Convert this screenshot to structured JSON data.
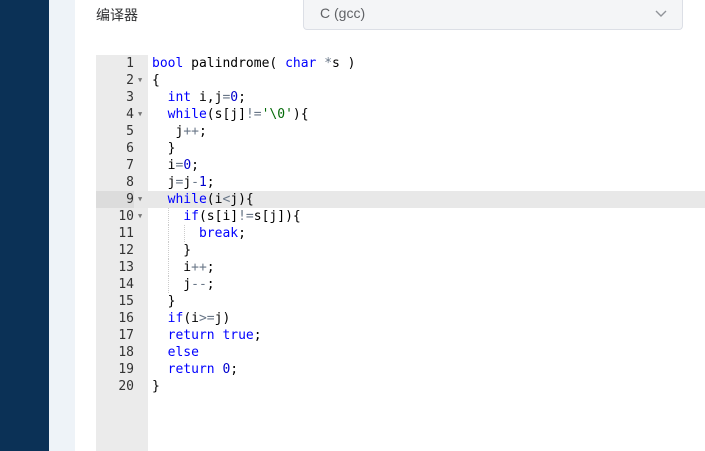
{
  "compiler": {
    "label": "编译器",
    "selected": "C (gcc)"
  },
  "editor": {
    "active_line": 9,
    "lines": [
      {
        "n": "1",
        "fold": false,
        "tokens": [
          [
            "kw",
            "bool"
          ],
          [
            "t",
            " palindrome( "
          ],
          [
            "kw",
            "char"
          ],
          [
            "t",
            " "
          ],
          [
            "op",
            "*"
          ],
          [
            "t",
            "s )"
          ]
        ]
      },
      {
        "n": "2",
        "fold": true,
        "tokens": [
          [
            "t",
            "{"
          ]
        ]
      },
      {
        "n": "3",
        "fold": false,
        "tokens": [
          [
            "t",
            "  "
          ],
          [
            "kw",
            "int"
          ],
          [
            "t",
            " i,j"
          ],
          [
            "op",
            "="
          ],
          [
            "num",
            "0"
          ],
          [
            "t",
            ";"
          ]
        ]
      },
      {
        "n": "4",
        "fold": true,
        "tokens": [
          [
            "t",
            "  "
          ],
          [
            "kw",
            "while"
          ],
          [
            "t",
            "(s[j]"
          ],
          [
            "op",
            "!="
          ],
          [
            "str",
            "'\\0'"
          ],
          [
            "t",
            "){"
          ]
        ]
      },
      {
        "n": "5",
        "fold": false,
        "tokens": [
          [
            "t",
            "   j"
          ],
          [
            "op",
            "++"
          ],
          [
            "t",
            ";"
          ]
        ]
      },
      {
        "n": "6",
        "fold": false,
        "tokens": [
          [
            "t",
            "  }"
          ]
        ]
      },
      {
        "n": "7",
        "fold": false,
        "tokens": [
          [
            "t",
            "  i"
          ],
          [
            "op",
            "="
          ],
          [
            "num",
            "0"
          ],
          [
            "t",
            ";"
          ]
        ]
      },
      {
        "n": "8",
        "fold": false,
        "tokens": [
          [
            "t",
            "  j"
          ],
          [
            "op",
            "="
          ],
          [
            "t",
            "j"
          ],
          [
            "op",
            "-"
          ],
          [
            "num",
            "1"
          ],
          [
            "t",
            ";"
          ]
        ]
      },
      {
        "n": "9",
        "fold": true,
        "tokens": [
          [
            "t",
            "  "
          ],
          [
            "kw",
            "while"
          ],
          [
            "t",
            "(i"
          ],
          [
            "op",
            "<"
          ],
          [
            "t",
            "j){"
          ]
        ]
      },
      {
        "n": "10",
        "fold": true,
        "tokens": [
          [
            "t",
            "    "
          ],
          [
            "kw",
            "if"
          ],
          [
            "t",
            "(s[i]"
          ],
          [
            "op",
            "!="
          ],
          [
            "t",
            "s[j]){"
          ]
        ]
      },
      {
        "n": "11",
        "fold": false,
        "tokens": [
          [
            "t",
            "      "
          ],
          [
            "kw",
            "break"
          ],
          [
            "t",
            ";"
          ]
        ]
      },
      {
        "n": "12",
        "fold": false,
        "tokens": [
          [
            "t",
            "    }"
          ]
        ]
      },
      {
        "n": "13",
        "fold": false,
        "tokens": [
          [
            "t",
            "    i"
          ],
          [
            "op",
            "++"
          ],
          [
            "t",
            ";"
          ]
        ]
      },
      {
        "n": "14",
        "fold": false,
        "tokens": [
          [
            "t",
            "    j"
          ],
          [
            "op",
            "--"
          ],
          [
            "t",
            ";"
          ]
        ]
      },
      {
        "n": "15",
        "fold": false,
        "tokens": [
          [
            "t",
            "  }"
          ]
        ]
      },
      {
        "n": "16",
        "fold": false,
        "tokens": [
          [
            "t",
            "  "
          ],
          [
            "kw",
            "if"
          ],
          [
            "t",
            "(i"
          ],
          [
            "op",
            ">="
          ],
          [
            "t",
            "j)"
          ]
        ]
      },
      {
        "n": "17",
        "fold": false,
        "tokens": [
          [
            "t",
            "  "
          ],
          [
            "kw",
            "return"
          ],
          [
            "t",
            " "
          ],
          [
            "kw",
            "true"
          ],
          [
            "t",
            ";"
          ]
        ]
      },
      {
        "n": "18",
        "fold": false,
        "tokens": [
          [
            "t",
            "  "
          ],
          [
            "kw",
            "else"
          ]
        ]
      },
      {
        "n": "19",
        "fold": false,
        "tokens": [
          [
            "t",
            "  "
          ],
          [
            "kw",
            "return"
          ],
          [
            "t",
            " "
          ],
          [
            "num",
            "0"
          ],
          [
            "t",
            ";"
          ]
        ]
      },
      {
        "n": "20",
        "fold": false,
        "tokens": [
          [
            "t",
            "}"
          ]
        ]
      }
    ]
  }
}
